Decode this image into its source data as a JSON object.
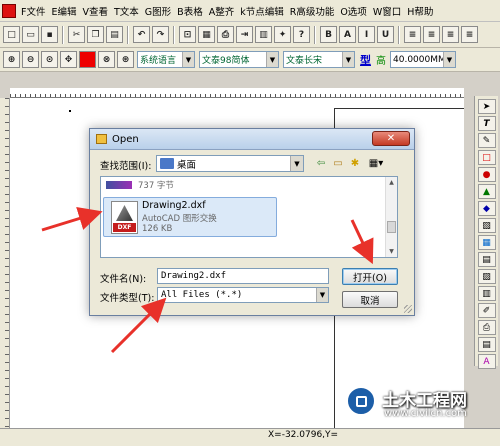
{
  "menu": [
    "F文件",
    "E编辑",
    "V查看",
    "T文本",
    "G图形",
    "B表格",
    "A整齐",
    "k节点编辑",
    "R高级功能",
    "O选项",
    "W窗口",
    "H帮助"
  ],
  "toolbar2": {
    "font_cn": "系统语言",
    "font_family": "文泰98简体",
    "style": "文泰长宋",
    "type_label": "型",
    "height_label": "高",
    "height_value": "40.0000MM"
  },
  "status": {
    "coords": "X=-32.0796,Y="
  },
  "dialog": {
    "title": "Open",
    "close_glyph": "✕",
    "look_in_label": "查找范围(I):",
    "look_in_value": "桌面",
    "files": [
      {
        "size": "737 字节"
      },
      {
        "name": "Drawing2.dxf",
        "type": "AutoCAD 图形交换",
        "size": "126 KB",
        "badge": "DXF"
      }
    ],
    "filename_label": "文件名(N):",
    "filename_value": "Drawing2.dxf",
    "filetype_label": "文件类型(T):",
    "filetype_value": "All Files (*.*)",
    "open_button": "打开(O)",
    "cancel_button": "取消"
  },
  "watermark": {
    "title": "土木工程网",
    "url": "www.civilcn.com"
  },
  "colors": {
    "arrow": "#e8312a",
    "selection": "#dbe9f8",
    "title_bar": "#b9d0ea",
    "close": "#c43a24"
  }
}
